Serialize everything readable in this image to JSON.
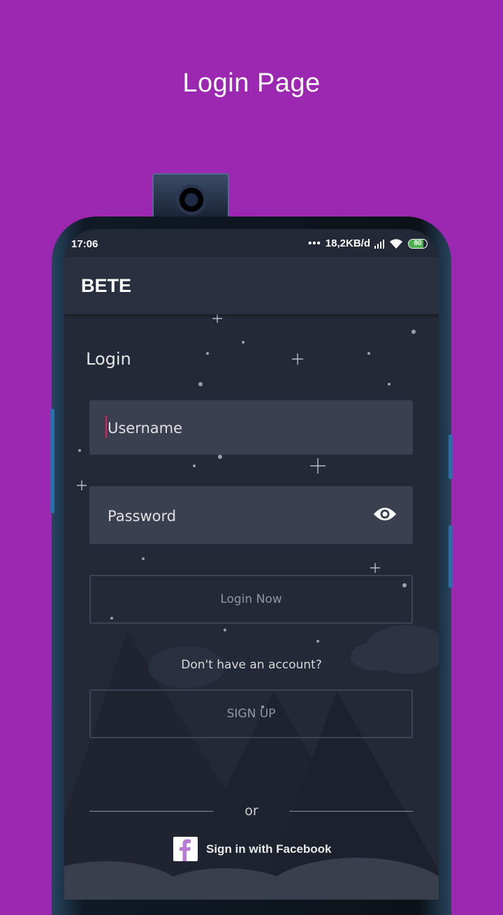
{
  "page": {
    "heading": "Login Page",
    "background": "#9c27b0"
  },
  "status_bar": {
    "time": "17:06",
    "network_speed": "18,2KB/d",
    "battery_level": "80",
    "battery_fraction": 0.8
  },
  "app_bar": {
    "title": "BETE"
  },
  "login": {
    "section_title": "Login",
    "username_placeholder": "Username",
    "password_placeholder": "Password",
    "login_button": "Login Now",
    "no_account_text": "Don't have an account?",
    "signup_button": "SIGN UP",
    "or_text": "or",
    "facebook_button": "Sign in with Facebook"
  },
  "colors": {
    "accent_cursor": "#e91e63",
    "screen_bg": "#232936",
    "field_bg": "#3b4050",
    "facebook_icon": "#b87ad6"
  }
}
